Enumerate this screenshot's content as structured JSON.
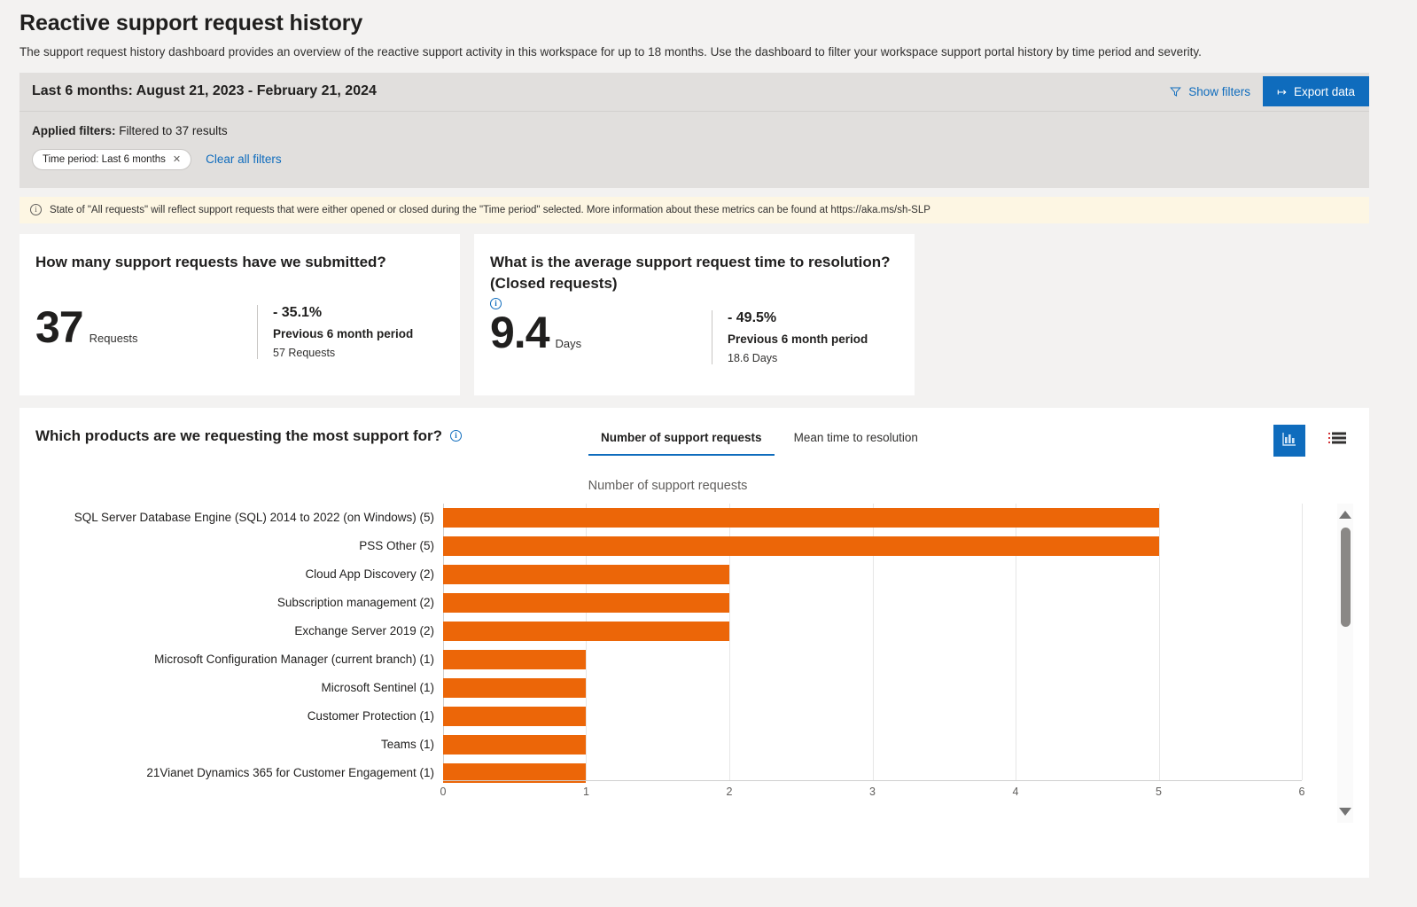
{
  "page": {
    "title": "Reactive support request history",
    "subtitle": "The support request history dashboard provides an overview of the reactive support activity in this workspace for up to 18 months. Use the dashboard to filter your workspace support portal history by time period and severity."
  },
  "filters": {
    "range_title": "Last 6 months: August 21, 2023 - February 21, 2024",
    "show_filters_label": "Show filters",
    "export_label": "Export data",
    "export_icon": "arrow-export-icon",
    "funnel_icon": "funnel-icon",
    "applied_label": "Applied filters:",
    "applied_value": "Filtered to 37 results",
    "chips": [
      {
        "label": "Time period: Last 6 months",
        "close_icon": "close-icon"
      }
    ],
    "clear_all_label": "Clear all filters"
  },
  "info_banner": {
    "icon": "info-icon",
    "text": "State of \"All requests\" will reflect support requests that were either opened or closed during the \"Time period\" selected. More information about these metrics can be found at https://aka.ms/sh-SLP"
  },
  "kpis": [
    {
      "question": "How many support requests have we submitted?",
      "has_info_icon": false,
      "value": "37",
      "unit": "Requests",
      "delta": "- 35.1%",
      "previous_label": "Previous 6 month period",
      "previous_value": "57 Requests"
    },
    {
      "question": "What is the average support request time to resolution?(Closed requests)",
      "has_info_icon": true,
      "value": "9.4",
      "unit": "Days",
      "delta": "- 49.5%",
      "previous_label": "Previous 6 month period",
      "previous_value": "18.6 Days"
    }
  ],
  "chart_section": {
    "question": "Which products are we requesting the most support for?",
    "info_icon": "info-icon",
    "tabs": [
      {
        "label": "Number of support requests",
        "active": true
      },
      {
        "label": "Mean time to resolution",
        "active": false
      }
    ],
    "view_buttons": [
      {
        "name": "chart-view-button",
        "icon": "bar-chart-icon",
        "active": true
      },
      {
        "name": "table-view-button",
        "icon": "list-view-icon",
        "active": false
      }
    ],
    "scrollbar": {
      "up_icon": "caret-up-icon",
      "down_icon": "caret-down-icon"
    }
  },
  "chart_data": {
    "type": "bar",
    "orientation": "horizontal",
    "title": "Number of support requests",
    "xlabel": "",
    "ylabel": "",
    "xlim": [
      0,
      6
    ],
    "xticks": [
      "0",
      "1",
      "2",
      "3",
      "4",
      "5",
      "6"
    ],
    "grid": true,
    "legend": "none",
    "bar_color": "#ec6608",
    "categories": [
      "SQL Server  Database Engine (SQL)  2014 to 2022 (on Windows) (5)",
      "PSS Other (5)",
      "Cloud App Discovery (2)",
      "Subscription management (2)",
      "Exchange Server 2019 (2)",
      "Microsoft Configuration Manager (current branch) (1)",
      "Microsoft Sentinel (1)",
      "Customer Protection (1)",
      "Teams (1)",
      "21Vianet Dynamics 365 for Customer Engagement (1)"
    ],
    "values": [
      5,
      5,
      2,
      2,
      2,
      1,
      1,
      1,
      1,
      1
    ]
  },
  "colors": {
    "accent": "#0f6cbd",
    "bar": "#ec6608",
    "page_bg": "#f3f2f1",
    "panel_bg": "#e1dfdd",
    "banner_bg": "#fdf6e3"
  }
}
